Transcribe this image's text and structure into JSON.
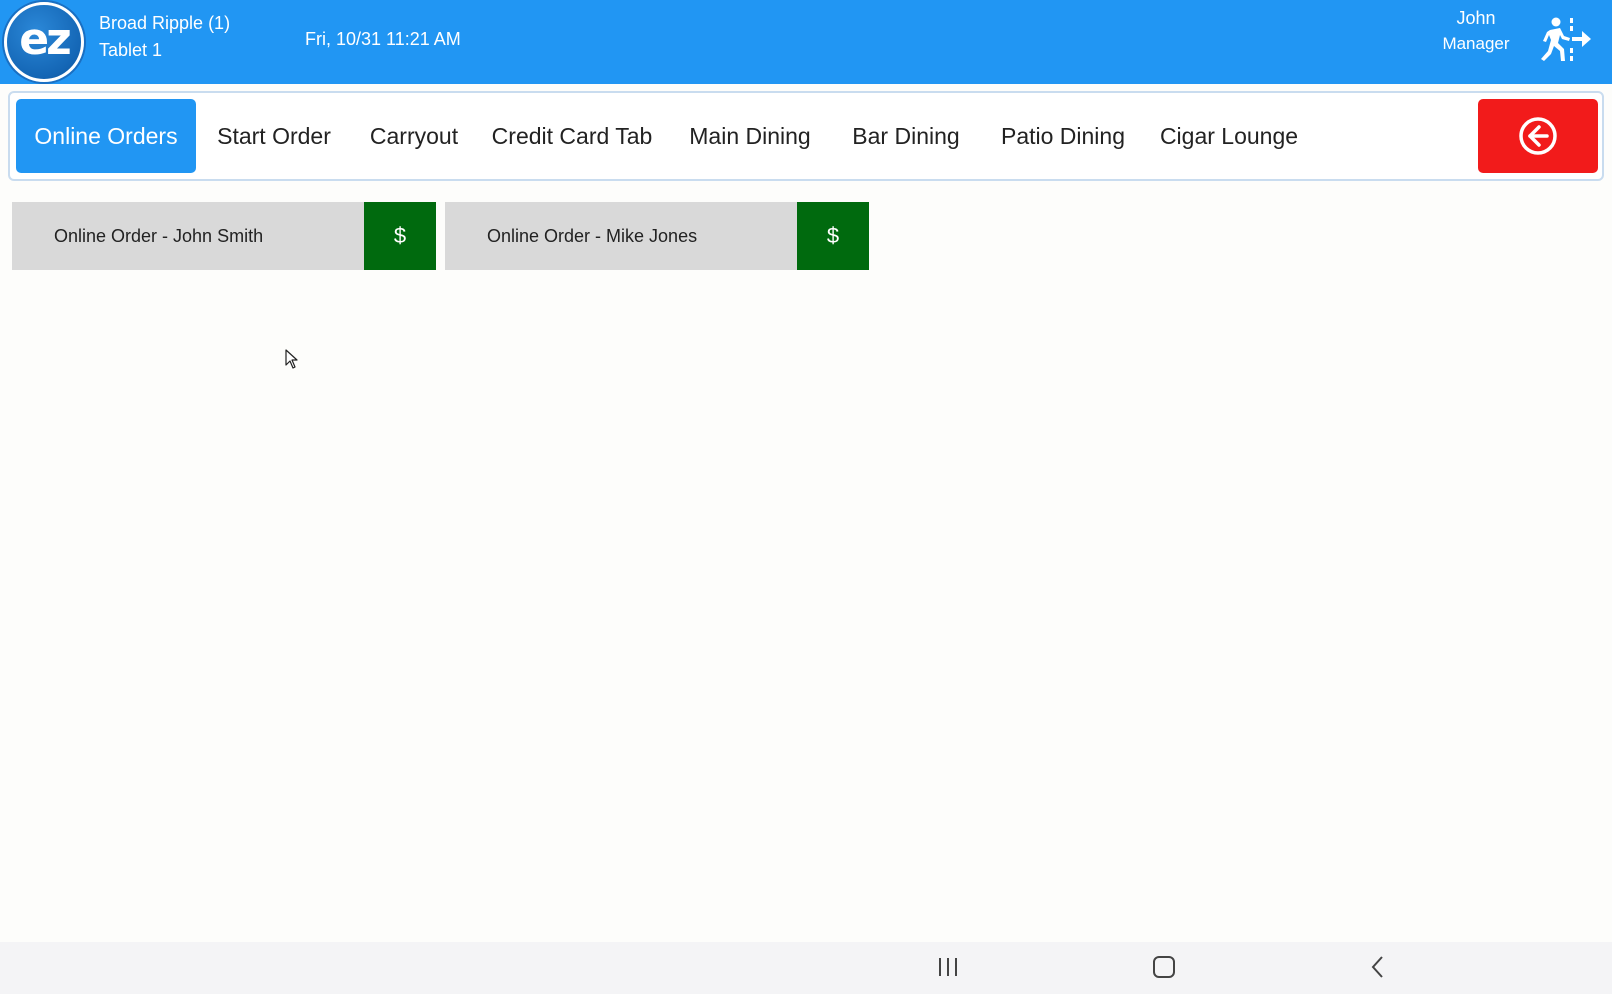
{
  "header": {
    "logo_text": "ez",
    "store_name": "Broad Ripple (1)",
    "device_name": "Tablet 1",
    "datetime": "Fri, 10/31 11:21 AM",
    "user_name": "John",
    "user_role": "Manager",
    "logout_icon": "logout-icon"
  },
  "nav": {
    "items": [
      {
        "label": "Online Orders",
        "active": true
      },
      {
        "label": "Start Order"
      },
      {
        "label": "Carryout"
      },
      {
        "label": "Credit Card Tab"
      },
      {
        "label": "Main Dining"
      },
      {
        "label": "Bar Dining"
      },
      {
        "label": "Patio Dining"
      },
      {
        "label": "Cigar Lounge"
      }
    ],
    "back_icon": "circle-arrow-left-icon"
  },
  "orders": [
    {
      "name": "Online Order - John Smith",
      "pay_label": "$"
    },
    {
      "name": "Online Order - Mike Jones",
      "pay_label": "$"
    }
  ],
  "system_nav": {
    "recents_icon": "recents-icon",
    "home_icon": "home-icon",
    "back_icon": "back-icon"
  },
  "colors": {
    "header_bg": "#2196f3",
    "active_tab": "#2196f3",
    "back_button": "#f21b1b",
    "pay_button": "#006a0e",
    "order_bg": "#d9d9d9"
  }
}
